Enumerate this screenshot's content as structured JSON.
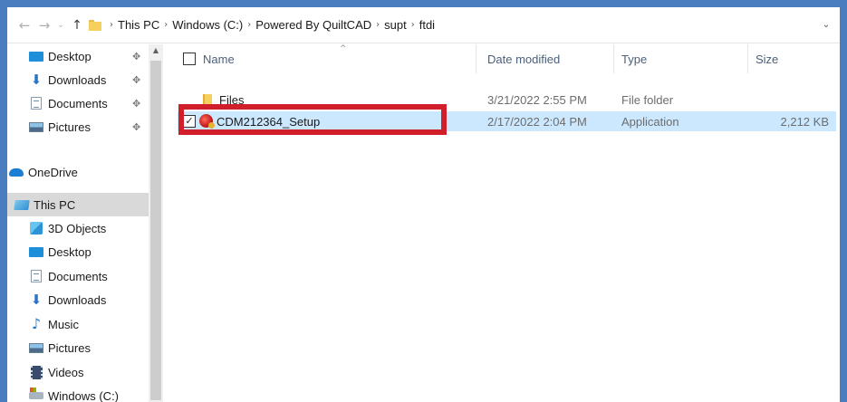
{
  "breadcrumb": [
    "This PC",
    "Windows (C:)",
    "Powered By QuiltCAD",
    "supt",
    "ftdi"
  ],
  "nav": {
    "quick_access": [
      {
        "label": "Desktop",
        "icon": "desktop-icon",
        "pinned": true
      },
      {
        "label": "Downloads",
        "icon": "download-icon",
        "pinned": true
      },
      {
        "label": "Documents",
        "icon": "document-icon",
        "pinned": true
      },
      {
        "label": "Pictures",
        "icon": "picture-icon",
        "pinned": true
      }
    ],
    "onedrive": "OneDrive",
    "this_pc": "This PC",
    "this_pc_items": [
      {
        "label": "3D Objects",
        "icon": "3d-objects-icon"
      },
      {
        "label": "Desktop",
        "icon": "desktop-icon"
      },
      {
        "label": "Documents",
        "icon": "document-icon"
      },
      {
        "label": "Downloads",
        "icon": "download-icon"
      },
      {
        "label": "Music",
        "icon": "music-icon"
      },
      {
        "label": "Pictures",
        "icon": "picture-icon"
      },
      {
        "label": "Videos",
        "icon": "videos-icon"
      },
      {
        "label": "Windows (C:)",
        "icon": "drive-icon"
      }
    ]
  },
  "columns": {
    "name": "Name",
    "date": "Date modified",
    "type": "Type",
    "size": "Size"
  },
  "files": [
    {
      "name": "Files",
      "date": "3/21/2022 2:55 PM",
      "type": "File folder",
      "size": "",
      "icon": "folder-icon",
      "selected": false
    },
    {
      "name": "CDM212364_Setup",
      "date": "2/17/2022 2:04 PM",
      "type": "Application",
      "size": "2,212 KB",
      "icon": "application-icon",
      "selected": true
    }
  ],
  "colors": {
    "selection": "#cce8ff",
    "highlight_box": "#d01f2a",
    "background": "#4a7cc0"
  }
}
